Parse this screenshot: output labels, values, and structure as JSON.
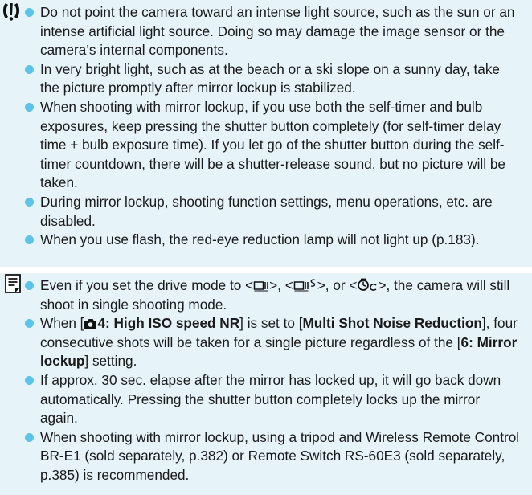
{
  "caution": {
    "icon": "caution-icon",
    "items": [
      {
        "text": "Do not point the camera toward an intense light source, such as the sun or an intense artificial light source. Doing so may damage the image sensor or the camera’s internal components."
      },
      {
        "text": "In very bright light, such as at the beach or a ski slope on a sunny day, take the picture promptly after mirror lockup is stabilized."
      },
      {
        "text": "When shooting with mirror lockup, if you use both the self-timer and bulb exposures, keep pressing the shutter button completely (for self-timer delay time + bulb exposure time). If you let go of the shutter button during the self-timer countdown, there will be a shutter-release sound, but no picture will be taken."
      },
      {
        "text": "During mirror lockup, shooting function settings, menu operations, etc. are disabled."
      },
      {
        "text": "When you use flash, the red-eye reduction lamp will not light up (p.183)."
      }
    ]
  },
  "notes": {
    "icon": "note-icon",
    "item1": {
      "t1": "Even if you set the drive mode to <",
      "t2": ">, <",
      "t3": ">, or <",
      "t4": ">, the camera will still shoot in single shooting mode."
    },
    "item2": {
      "t1": "When [",
      "b1": "4: High ISO speed NR",
      "t2": "] is set to [",
      "b2": "Multi Shot Noise Reduction",
      "t3": "], four consecutive shots will be taken for a single picture regardless of the [",
      "b3": "6: Mirror lockup",
      "t4": "] setting."
    },
    "item3": {
      "text": "If approx. 30 sec. elapse after the mirror has locked up, it will go back down automatically. Pressing the shutter button completely locks up the mirror again."
    },
    "item4": {
      "text": "When shooting with mirror lockup, using a tripod and Wireless Remote Control BR-E1 (sold separately, p.382) or Remote Switch RS-60E3 (sold separately, p.385) is recommended."
    }
  }
}
